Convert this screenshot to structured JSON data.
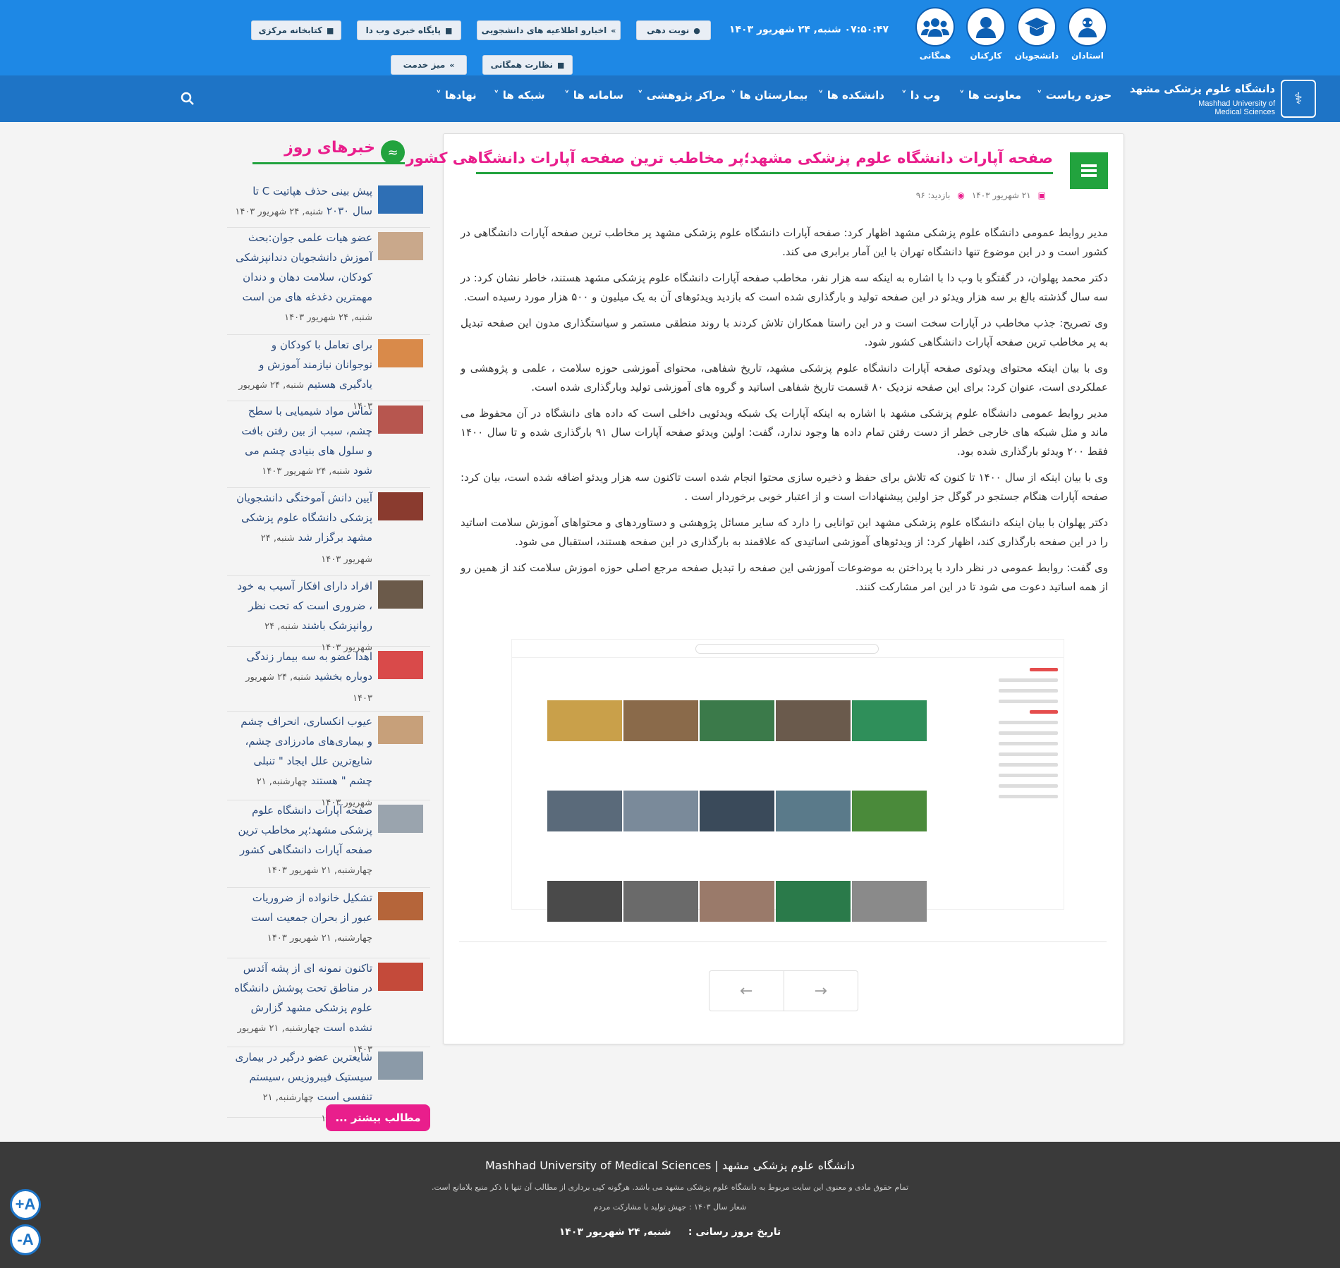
{
  "header": {
    "roles": [
      {
        "label": "استادان",
        "icon": "professor-icon"
      },
      {
        "label": "دانشجویان",
        "icon": "graduation-cap-icon"
      },
      {
        "label": "کارکنان",
        "icon": "staff-user-icon"
      },
      {
        "label": "همگانی",
        "icon": "group-users-icon"
      }
    ],
    "datetime": "۰۷:۵۰:۴۷ شنبه, ۲۴ شهریور ۱۴۰۳",
    "quick_links": [
      {
        "label": "نوبت دهی",
        "icon": "user-icon"
      },
      {
        "label": "اخبارو اطلاعیه های دانشجویی",
        "icon": "double-chevron-icon"
      },
      {
        "label": "پایگاه خبری وب دا",
        "icon": "document-icon"
      },
      {
        "label": "کتابخانه مرکزی",
        "icon": "document-icon"
      },
      {
        "label": "نظارت همگانی",
        "icon": "document-icon"
      },
      {
        "label": "میز خدمت",
        "icon": "double-chevron-icon"
      }
    ]
  },
  "logo": {
    "fa": "دانشگاه علوم پزشکی مشهد",
    "en_line1": "Mashhad University of",
    "en_line2": "Medical Sciences"
  },
  "nav": [
    "حوزه ریاست",
    "معاونت ها",
    "وب دا",
    "دانشکده ها",
    "بیمارستان ها",
    "مراکز پژوهشی",
    "سامانه ها",
    "شبکه ها",
    "نهادها"
  ],
  "article": {
    "title": "صفحه آپارات دانشگاه علوم پزشکی مشهد؛پر مخاطب ترین صفحه آپارات دانشگاهی کشور",
    "date": "۲۱ شهریور ۱۴۰۳",
    "views": "بازدید: ۹۶",
    "paragraphs": [
      "مدیر روابط عمومی دانشگاه علوم پزشکی مشهد اظهار کرد: صفحه آپارات دانشگاه علوم پزشکی مشهد پر مخاطب ترین صفحه آپارات دانشگاهی در کشور است  و در این موضوع تنها دانشگاه تهران  با این آمار برابری می کند.",
      "دکتر محمد پهلوان، در گفتگو با وب دا با اشاره به اینکه سه هزار نفر، مخاطب صفحه آپارات دانشگاه علوم پزشکی مشهد هستند، خاطر نشان کرد: در سه سال گذشته بالغ بر سه هزار ویدئو در این صفحه تولید و بارگذاری شده است که  بازدید ویدئوهای آن  به یک میلیون و ۵۰۰ هزار مورد رسیده است.",
      "وی تصریح:  جذب مخاطب در آپارات سخت است و در این راستا  همکاران تلاش کردند با روند منطقی مستمر و سیاستگذاری مدون این صفحه تبدیل به پر مخاطب ترین صفحه آپارات دانشگاهی کشور شود.",
      "وی با بیان اینکه محتوای ویدئوی صفحه آپارات دانشگاه علوم پزشکی مشهد، تاریخ شفاهی، محتوای آموزشی حوزه سلامت ، علمی و پژوهشی و عملکردی است، عنوان کرد: برای این صفحه نزدیک ۸۰ قسمت تاریخ شفاهی اساتید و گروه های  آموزشی تولید وبارگذاری شده است.",
      "مدیر روابط عمومی دانشگاه علوم پزشکی مشهد با اشاره به اینکه آپارات یک شبکه ویدئویی داخلی است که داده های دانشگاه در آن محفوظ می ماند و مثل شبکه های خارجی  خطر از دست رفتن تمام داده ها وجود ندارد، گفت: اولین ویدئو صفحه آپارات سال ۹۱ بارگذاری شده و تا سال ۱۴۰۰ فقط ۲۰۰ ویدئو بارگذاری شده بود.",
      "وی با بیان اینکه از سال ۱۴۰۰ تا کنون که تلاش برای حفظ و ذخیره سازی محتوا  انجام شده است تاکنون سه هزار ویدئو اضافه شده است، بیان کرد:  صفحه آپارات هنگام جستجو در گوگل جز اولین پیشنهادات است و از اعتبار خوبی برخوردار است .",
      "دکتر پهلوان با بیان اینکه دانشگاه علوم پزشکی مشهد این توانایی را دارد که سایر مسائل پژوهشی و دستاوردهای و محتواهای آموزش سلامت اساتید را در این صفحه بارگذاری کند، اظهار کرد: از ویدئوهای آموزشی اساتیدی که علاقمند به بارگذاری در این صفحه هستند، استقبال می شود.",
      "وی گفت: روابط عمومی در نظر دارد با پرداختن به موضوعات آموزشی این صفحه را تبدیل صفحه مرجع اصلی حوزه اموزش سلامت کند از همین رو از همه اساتید دعوت می شود تا در این امر مشارکت کنند."
    ]
  },
  "sidebar": {
    "title": "خبرهای روز",
    "more_label": "مطالب بیشتر ...",
    "items": [
      {
        "title": "پیش بینی حذف هپاتیت C تا سال ۲۰۳۰",
        "date": "شنبه, ۲۴ شهریور ۱۴۰۳",
        "thumb_color": "#2e6fb5"
      },
      {
        "title": "عضو هیات علمی جوان:بحث آموزش دانشجویان دندانپزشکی کودکان، سلامت دهان و دندان مهمترین دغدغه های من است",
        "date": "شنبه, ۲۴ شهریور ۱۴۰۳",
        "thumb_color": "#c9a88b"
      },
      {
        "title": "برای تعامل با کودکان و نوجوانان نیازمند آموزش و یادگیری هستیم",
        "date": "شنبه, ۲۴ شهریور ۱۴۰۳",
        "thumb_color": "#d98a4a"
      },
      {
        "title": "تماس مواد شیمیایی با سطح چشم، سبب از بین رفتن بافت و سلول های بنیادی چشم می شود",
        "date": "شنبه, ۲۴ شهریور ۱۴۰۳",
        "thumb_color": "#b7564f"
      },
      {
        "title": "آیین دانش آموختگی دانشجویان پزشکی دانشگاه علوم پزشکی مشهد برگزار شد",
        "date": "شنبه, ۲۴ شهریور ۱۴۰۳",
        "thumb_color": "#8a3b2f"
      },
      {
        "title": "افراد دارای افکار آسیب به خود ، ضروری است که تحت نظر روانپزشک باشند",
        "date": "شنبه, ۲۴ شهریور ۱۴۰۳",
        "thumb_color": "#6b5a4a"
      },
      {
        "title": "اهدا عضو به سه بیمار زندگی دوباره بخشید",
        "date": "شنبه, ۲۴ شهریور ۱۴۰۳",
        "thumb_color": "#d94a4a"
      },
      {
        "title": "عیوب انکساری، انحراف چشم و بیماری‌های مادرزادی چشم، شایع‌ترین علل ایجاد \" تنبلی چشم \" هستند",
        "date": "چهارشنبه, ۲۱ شهریور ۱۴۰۳",
        "thumb_color": "#c7a07a"
      },
      {
        "title": "صفحه آپارات دانشگاه علوم پزشکی مشهد؛پر مخاطب ترین صفحه آپارات دانشگاهی کشور",
        "date": "چهارشنبه, ۲۱ شهریور ۱۴۰۳",
        "thumb_color": "#9aa4ae"
      },
      {
        "title": "تشکیل خانواده از ضروریات عبور از بحران جمعیت است",
        "date": "چهارشنبه, ۲۱ شهریور ۱۴۰۳",
        "thumb_color": "#b5653a"
      },
      {
        "title": "تاکنون نمونه ای از پشه آئدس در مناطق تحت پوشش دانشگاه علوم پزشکی مشهد گزارش نشده است",
        "date": "چهارشنبه, ۲۱ شهریور ۱۴۰۳",
        "thumb_color": "#c44a3a"
      },
      {
        "title": "شایعترین عضو درگیر در بیماری سیستیک فیبروزیس ،سیستم تنفسی است",
        "date": "چهارشنبه, ۲۱ شهریور ۱۴۰۳",
        "thumb_color": "#8b9aa8"
      }
    ]
  },
  "footer": {
    "line1": "دانشگاه علوم پزشکی مشهد | Mashhad University of Medical Sciences",
    "line2": "تمام حقوق مادی و معنوی این سایت مربوط به دانشگاه علوم پزشکی مشهد می باشد. هرگونه کپی برداری از مطالب آن تنها با ذکر منبع بلامانع است.",
    "line3": "شعار سال ۱۴۰۳ : جهش تولید با مشارکت مردم",
    "update_label": "تاریخ بروز رسانی :",
    "update_date": "شنبه, ۲۴ شهریور ۱۴۰۳"
  },
  "accessibility": {
    "increase": "A+",
    "decrease": "A-"
  }
}
